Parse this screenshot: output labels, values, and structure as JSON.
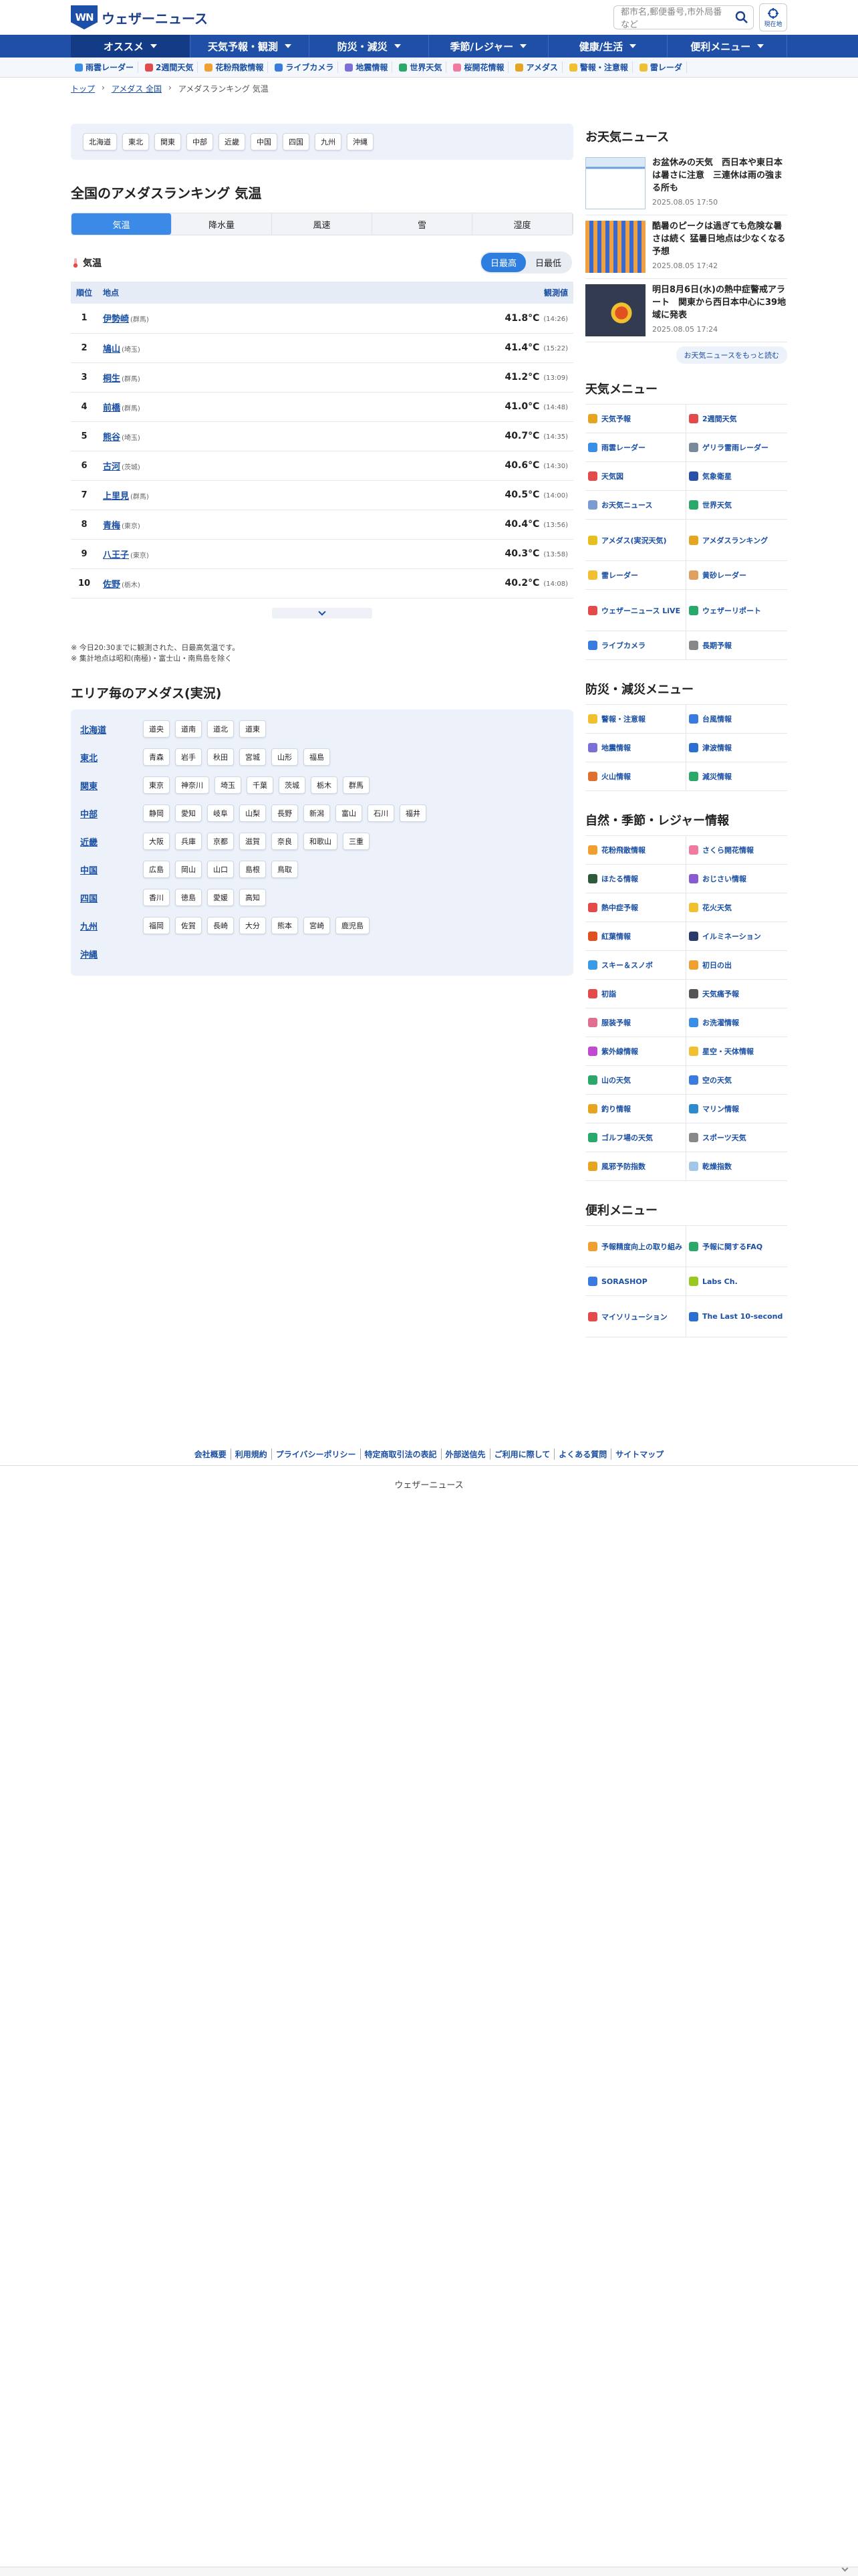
{
  "header": {
    "logo_mark": "WN",
    "logo_text": "ウェザーニュース",
    "search_placeholder": "都市名,郵便番号,市外局番など",
    "location_label": "現在地"
  },
  "mainnav": [
    {
      "label": "オススメ"
    },
    {
      "label": "天気予報・観測"
    },
    {
      "label": "防災・減災"
    },
    {
      "label": "季節/レジャー"
    },
    {
      "label": "健康/生活"
    },
    {
      "label": "便利メニュー"
    }
  ],
  "subnav": [
    {
      "label": "雨雲レーダー",
      "color": "#3a8ee6"
    },
    {
      "label": "2週間天気",
      "color": "#e34b4b"
    },
    {
      "label": "花粉飛散情報",
      "color": "#f0a030"
    },
    {
      "label": "ライブカメラ",
      "color": "#3a7be0"
    },
    {
      "label": "地震情報",
      "color": "#7c6fd6"
    },
    {
      "label": "世界天気",
      "color": "#2aa86a"
    },
    {
      "label": "桜開花情報",
      "color": "#f07aa0"
    },
    {
      "label": "アメダス",
      "color": "#e6a520"
    },
    {
      "label": "警報・注意報",
      "color": "#f0c030"
    },
    {
      "label": "雷レーダ",
      "color": "#f0c030"
    }
  ],
  "breadcrumb": {
    "home": "トップ",
    "sep1": "›",
    "amedas": "アメダス 全国",
    "sep2": "›",
    "current": "アメダスランキング 気温"
  },
  "regions": [
    "北海道",
    "東北",
    "関東",
    "中部",
    "近畿",
    "中国",
    "四国",
    "九州",
    "沖縄"
  ],
  "title": "全国のアメダスランキング 気温",
  "tabs": [
    "気温",
    "降水量",
    "風速",
    "雪",
    "湿度"
  ],
  "section_label": "気温",
  "toggle": {
    "on": "日最高",
    "off": "日最低"
  },
  "table": {
    "headers": {
      "rank": "順位",
      "place": "地点",
      "value": "観測値"
    },
    "rows": [
      {
        "rank": "1",
        "place": "伊勢崎",
        "pref": "(群馬)",
        "value": "41.8°C",
        "time": "(14:26)"
      },
      {
        "rank": "2",
        "place": "鳩山",
        "pref": "(埼玉)",
        "value": "41.4°C",
        "time": "(15:22)"
      },
      {
        "rank": "3",
        "place": "桐生",
        "pref": "(群馬)",
        "value": "41.2°C",
        "time": "(13:09)"
      },
      {
        "rank": "4",
        "place": "前橋",
        "pref": "(群馬)",
        "value": "41.0°C",
        "time": "(14:48)"
      },
      {
        "rank": "5",
        "place": "熊谷",
        "pref": "(埼玉)",
        "value": "40.7°C",
        "time": "(14:35)"
      },
      {
        "rank": "6",
        "place": "古河",
        "pref": "(茨城)",
        "value": "40.6°C",
        "time": "(14:30)"
      },
      {
        "rank": "7",
        "place": "上里見",
        "pref": "(群馬)",
        "value": "40.5°C",
        "time": "(14:00)"
      },
      {
        "rank": "8",
        "place": "青梅",
        "pref": "(東京)",
        "value": "40.4°C",
        "time": "(13:56)"
      },
      {
        "rank": "9",
        "place": "八王子",
        "pref": "(東京)",
        "value": "40.3°C",
        "time": "(13:58)"
      },
      {
        "rank": "10",
        "place": "佐野",
        "pref": "(栃木)",
        "value": "40.2°C",
        "time": "(14:08)"
      }
    ]
  },
  "notes": [
    "※ 今日20:30までに観測された、日最高気温です。",
    "※ 集計地点は昭和(南極)・富士山・南鳥島を除く"
  ],
  "area_title": "エリア毎のアメダス(実況)",
  "areas": [
    {
      "name": "北海道",
      "items": [
        "道央",
        "道南",
        "道北",
        "道東"
      ]
    },
    {
      "name": "東北",
      "items": [
        "青森",
        "岩手",
        "秋田",
        "宮城",
        "山形",
        "福島"
      ]
    },
    {
      "name": "関東",
      "items": [
        "東京",
        "神奈川",
        "埼玉",
        "千葉",
        "茨城",
        "栃木",
        "群馬"
      ]
    },
    {
      "name": "中部",
      "items": [
        "静岡",
        "愛知",
        "岐阜",
        "山梨",
        "長野",
        "新潟",
        "富山",
        "石川",
        "福井"
      ]
    },
    {
      "name": "近畿",
      "items": [
        "大阪",
        "兵庫",
        "京都",
        "滋賀",
        "奈良",
        "和歌山",
        "三重"
      ]
    },
    {
      "name": "中国",
      "items": [
        "広島",
        "岡山",
        "山口",
        "島根",
        "鳥取"
      ]
    },
    {
      "name": "四国",
      "items": [
        "香川",
        "徳島",
        "愛媛",
        "高知"
      ]
    },
    {
      "name": "九州",
      "items": [
        "福岡",
        "佐賀",
        "長崎",
        "大分",
        "熊本",
        "宮崎",
        "鹿児島"
      ]
    },
    {
      "name": "沖縄",
      "items": []
    }
  ],
  "side": {
    "news_title": "お天気ニュース",
    "news": [
      {
        "title": "お盆休みの天気　西日本や東日本は暑さに注意　三連休は雨の強まる所も",
        "date": "2025.08.05 17:50",
        "color": "#8fb8e8"
      },
      {
        "title": "酷暑のピークは過ぎても危険な暑さは続く 猛暑日地点は少なくなる予想",
        "date": "2025.08.05 17:42",
        "color": "#2b4fa8"
      },
      {
        "title": "明日8月6日(水)の熱中症警戒アラート　関東から西日本中心に39地域に発表",
        "date": "2025.08.05 17:24",
        "color": "#333b50"
      }
    ],
    "news_more": "お天気ニュースをもっと読む",
    "menu1_title": "天気メニュー",
    "menu1": [
      {
        "label": "天気予報",
        "color": "#e6a520"
      },
      {
        "label": "2週間天気",
        "color": "#e34b4b"
      },
      {
        "label": "雨雲レーダー",
        "color": "#3a8ee6"
      },
      {
        "label": "ゲリラ雷雨レーダー",
        "color": "#7a8a9a"
      },
      {
        "label": "天気図",
        "color": "#e34b4b"
      },
      {
        "label": "気象衛星",
        "color": "#2b4fa8"
      },
      {
        "label": "お天気ニュース",
        "color": "#7c9bd0"
      },
      {
        "label": "世界天気",
        "color": "#2aa86a"
      },
      {
        "label": "アメダス(実況天気)",
        "color": "#e6c020"
      },
      {
        "label": "アメダスランキング",
        "color": "#e6a520"
      },
      {
        "label": "雷レーダー",
        "color": "#f0c030"
      },
      {
        "label": "黄砂レーダー",
        "color": "#e0a060"
      },
      {
        "label": "ウェザーニュース LiVE",
        "color": "#e34b4b"
      },
      {
        "label": "ウェザーリポート",
        "color": "#2aa86a"
      },
      {
        "label": "ライブカメラ",
        "color": "#3a7be0"
      },
      {
        "label": "長期予報",
        "color": "#888888"
      }
    ],
    "menu2_title": "防災・減災メニュー",
    "menu2": [
      {
        "label": "警報・注意報",
        "color": "#f0c030"
      },
      {
        "label": "台風情報",
        "color": "#3a7be0"
      },
      {
        "label": "地震情報",
        "color": "#7c6fd6"
      },
      {
        "label": "津波情報",
        "color": "#2b6fd0"
      },
      {
        "label": "火山情報",
        "color": "#e07030"
      },
      {
        "label": "減災情報",
        "color": "#2aa86a"
      }
    ],
    "menu3_title": "自然・季節・レジャー情報",
    "menu3": [
      {
        "label": "花粉飛散情報",
        "color": "#f0a030"
      },
      {
        "label": "さくら開花情報",
        "color": "#f07aa0"
      },
      {
        "label": "ほたる情報",
        "color": "#2e5a3a"
      },
      {
        "label": "おじさい情報",
        "color": "#8a5ad0"
      },
      {
        "label": "熱中症予報",
        "color": "#e34b4b"
      },
      {
        "label": "花火天気",
        "color": "#f0c030"
      },
      {
        "label": "紅葉情報",
        "color": "#e05020"
      },
      {
        "label": "イルミネーション",
        "color": "#2a3a6a"
      },
      {
        "label": "スキー＆スノボ",
        "color": "#3a9ae6"
      },
      {
        "label": "初日の出",
        "color": "#f0a030"
      },
      {
        "label": "初詣",
        "color": "#e34b4b"
      },
      {
        "label": "天気痛予報",
        "color": "#555555"
      },
      {
        "label": "服装予報",
        "color": "#e07090"
      },
      {
        "label": "お洗濯情報",
        "color": "#3a8ee6"
      },
      {
        "label": "紫外線情報",
        "color": "#c04ad0"
      },
      {
        "label": "星空・天体情報",
        "color": "#f0c030"
      },
      {
        "label": "山の天気",
        "color": "#2aa86a"
      },
      {
        "label": "空の天気",
        "color": "#3a7be0"
      },
      {
        "label": "釣り情報",
        "color": "#e6a520"
      },
      {
        "label": "マリン情報",
        "color": "#2b8ad0"
      },
      {
        "label": "ゴルフ場の天気",
        "color": "#2aa86a"
      },
      {
        "label": "スポーツ天気",
        "color": "#888888"
      },
      {
        "label": "風邪予防指数",
        "color": "#e6a520"
      },
      {
        "label": "乾燥指数",
        "color": "#a0c8e8"
      }
    ],
    "menu4_title": "便利メニュー",
    "menu4": [
      {
        "label": "予報精度向上の取り組み",
        "color": "#f0a030"
      },
      {
        "label": "予報に関するFAQ",
        "color": "#2aa86a"
      },
      {
        "label": "SORASHOP",
        "color": "#3a7be0"
      },
      {
        "label": "Labs Ch.",
        "color": "#9ac820"
      },
      {
        "label": "マイソリューション",
        "color": "#e34b4b"
      },
      {
        "label": "The Last 10-second",
        "color": "#2b6fd0"
      }
    ]
  },
  "footer": {
    "links": [
      "会社概要",
      "利用規約",
      "プライバシーポリシー",
      "特定商取引法の表記",
      "外部送信先",
      "ご利用に際して",
      "よくある質問",
      "サイトマップ"
    ],
    "copy": "ウェザーニュース"
  }
}
